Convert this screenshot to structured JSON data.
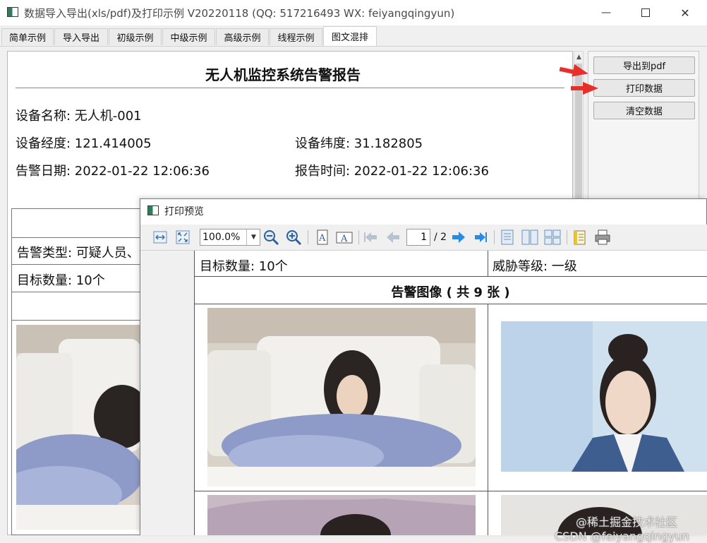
{
  "window": {
    "title": "数据导入导出(xls/pdf)及打印示例 V20220118 (QQ: 517216493 WX: feiyangqingyun)",
    "minimize_icon": "minimize-icon",
    "maximize_icon": "maximize-icon",
    "close_icon": "close-icon"
  },
  "tabs": [
    {
      "label": "简单示例"
    },
    {
      "label": "导入导出"
    },
    {
      "label": "初级示例"
    },
    {
      "label": "中级示例"
    },
    {
      "label": "高级示例"
    },
    {
      "label": "线程示例"
    },
    {
      "label": "图文混排",
      "active": true
    }
  ],
  "report": {
    "title": "无人机监控系统告警报告",
    "device_name": "设备名称: 无人机-001",
    "longitude": "设备经度: 121.414005",
    "latitude": "设备纬度: 31.182805",
    "alarm_date": "告警日期: 2022-01-22 12:06:36",
    "report_time": "报告时间: 2022-01-22 12:06:36",
    "alarm_type": "告警类型: 可疑人员、di",
    "target_count": "目标数量: 10个"
  },
  "actions": {
    "export_pdf": "导出到pdf",
    "print_data": "打印数据",
    "clear_data": "清空数据",
    "arrow_color": "#e8302a"
  },
  "preview": {
    "title": "打印预览",
    "zoom": "100.0%",
    "page_current": "1",
    "page_total": "/ 2",
    "target_count": "目标数量: 10个",
    "threat_level": "威胁等级: 一级",
    "image_header": "告警图像 ( 共 9 张 )"
  },
  "watermark": "@稀土掘金技术社区\nCSDN @feiyangqingyun"
}
